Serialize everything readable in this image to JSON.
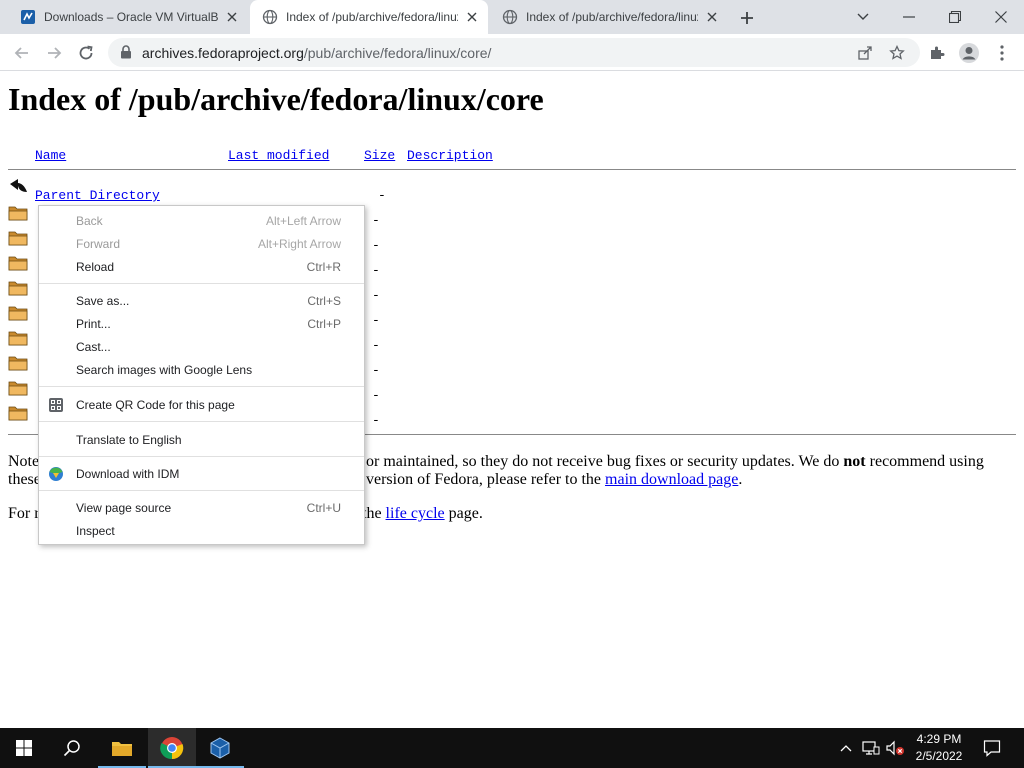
{
  "tabs": [
    {
      "title": "Downloads – Oracle VM VirtualBox",
      "active": false
    },
    {
      "title": "Index of /pub/archive/fedora/linux/core",
      "active": true
    },
    {
      "title": "Index of /pub/archive/fedora/linux/core",
      "active": false
    }
  ],
  "address_bar": {
    "host": "archives.fedoraproject.org",
    "path": "/pub/archive/fedora/linux/core/"
  },
  "page": {
    "title": "Index of /pub/archive/fedora/linux/core",
    "columns": {
      "name": "Name",
      "last_modified": "Last modified",
      "size": "Size",
      "description": "Description"
    },
    "parent_directory": "Parent Directory",
    "parent_size": "-",
    "folder_row_sizes": [
      "-",
      "-",
      "-",
      "-",
      "-",
      "-",
      "-",
      "-",
      "-"
    ],
    "notice": {
      "p1_start": "Note",
      "p1_mid": "or maintained, so they do not receive bug fixes or security updates. We do",
      "p1_bold": "not",
      "p1_end": "recommend using",
      "p1_line2_start": "these",
      "p1_line2_mid": "version of Fedora, please refer to the",
      "p1_link": "main download page",
      "p1_line2_end": ".",
      "p2_start": "For r",
      "p2_mid": "the",
      "p2_link": "life cycle",
      "p2_end": "page."
    }
  },
  "context_menu": {
    "items": [
      {
        "label": "Back",
        "shortcut": "Alt+Left Arrow",
        "disabled": true
      },
      {
        "label": "Forward",
        "shortcut": "Alt+Right Arrow",
        "disabled": true
      },
      {
        "label": "Reload",
        "shortcut": "Ctrl+R",
        "disabled": false
      },
      {
        "label": "Save as...",
        "shortcut": "Ctrl+S",
        "disabled": false
      },
      {
        "label": "Print...",
        "shortcut": "Ctrl+P",
        "disabled": false
      },
      {
        "label": "Cast...",
        "shortcut": "",
        "disabled": false
      },
      {
        "label": "Search images with Google Lens",
        "shortcut": "",
        "disabled": false
      },
      {
        "label": "Create QR Code for this page",
        "shortcut": "",
        "icon": "qr-code-icon",
        "disabled": false
      },
      {
        "label": "Translate to English",
        "shortcut": "",
        "disabled": false
      },
      {
        "label": "Download with IDM",
        "shortcut": "",
        "icon": "idm-icon",
        "disabled": false
      },
      {
        "label": "View page source",
        "shortcut": "Ctrl+U",
        "disabled": false
      },
      {
        "label": "Inspect",
        "shortcut": "",
        "disabled": false
      }
    ]
  },
  "taskbar": {
    "clock_time": "4:29 PM",
    "clock_date": "2/5/2022"
  },
  "colors": {
    "link": "#0000ee",
    "tabstrip": "#dee1e6",
    "taskbar": "#101010",
    "folder": "#f0b860"
  }
}
